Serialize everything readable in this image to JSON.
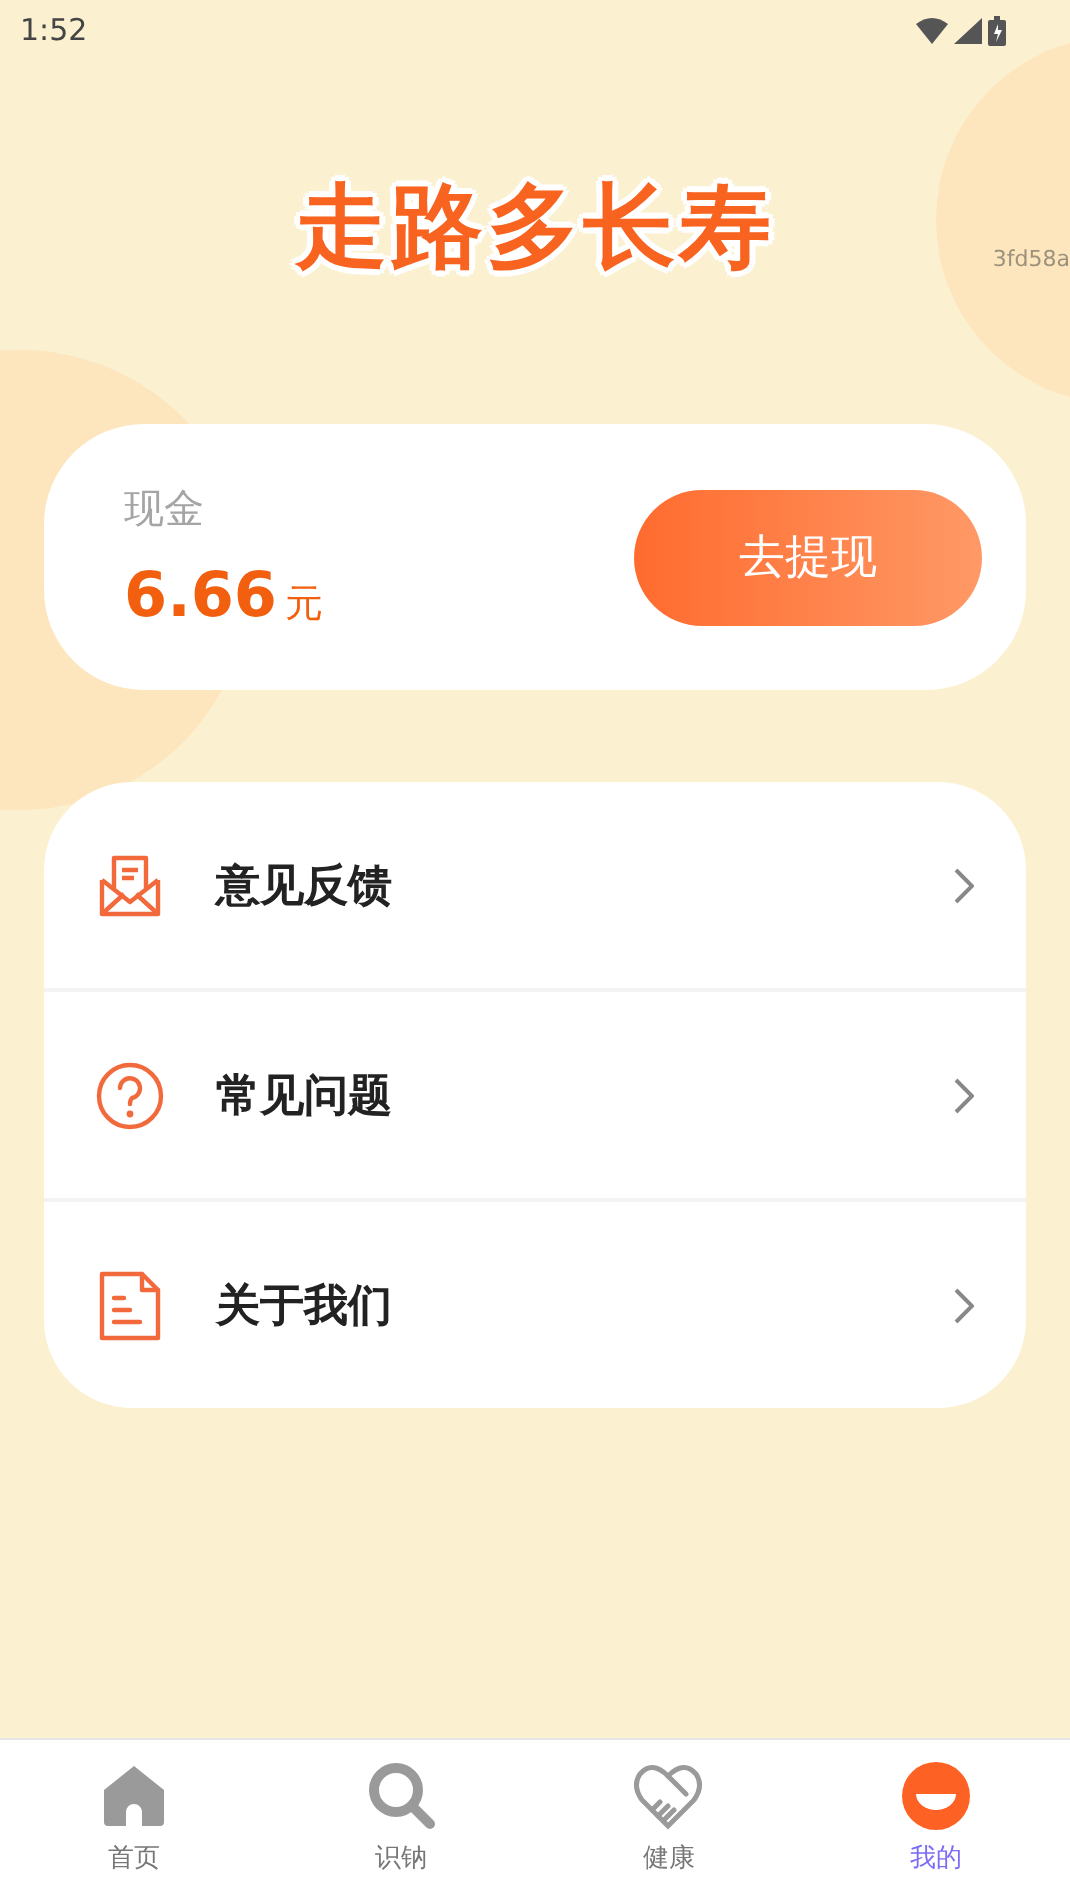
{
  "status_bar": {
    "time": "1:52"
  },
  "header": {
    "title": "走路多长寿",
    "tag": "3fd58a"
  },
  "cash_card": {
    "label": "现金",
    "amount": "6.66",
    "unit": "元",
    "button": "去提现"
  },
  "menu": [
    {
      "kind": "mail",
      "label": "意见反馈"
    },
    {
      "kind": "question",
      "label": "常见问题"
    },
    {
      "kind": "document",
      "label": "关于我们"
    }
  ],
  "tab_bar": [
    {
      "kind": "home",
      "label": "首页",
      "selected": false
    },
    {
      "kind": "search",
      "label": "识钠",
      "selected": false
    },
    {
      "kind": "heart",
      "label": "健康",
      "selected": false
    },
    {
      "kind": "face",
      "label": "我的",
      "selected": true
    }
  ]
}
